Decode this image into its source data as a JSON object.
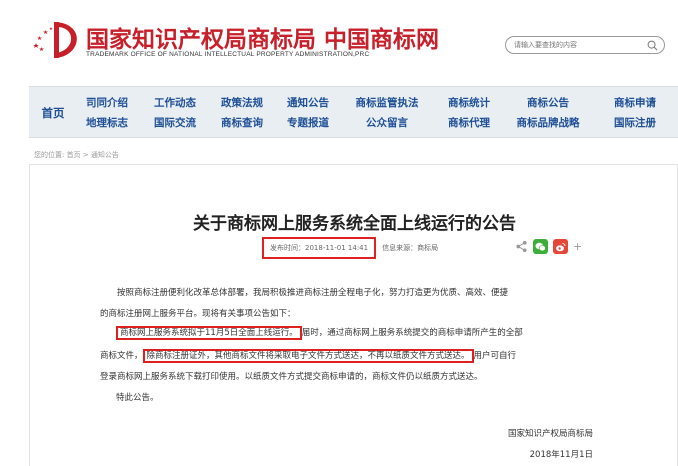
{
  "header": {
    "title_cn": "国家知识产权局商标局 中国商标网",
    "title_en": "TRADEMARK OFFICE OF NATIONAL INTELLECTUAL PROPERTY ADMINISTRATION,PRC",
    "search_placeholder": "请输入要查找的内容"
  },
  "nav": {
    "home": "首页",
    "items": [
      {
        "line1": "司同介绍",
        "line2": "地理标志"
      },
      {
        "line1": "工作动态",
        "line2": "国际交流"
      },
      {
        "line1": "政策法规",
        "line2": "商标查询"
      },
      {
        "line1": "通知公告",
        "line2": "专题报道"
      },
      {
        "line1": "商标监管执法",
        "line2": "公众留言"
      },
      {
        "line1": "商标统计",
        "line2": "商标代理"
      },
      {
        "line1": "商标公告",
        "line2": "商标品牌战略"
      },
      {
        "line1": "商标申请",
        "line2": "国际注册"
      }
    ]
  },
  "breadcrumb": "您的位置: 首页 > 通知公告",
  "article": {
    "title": "关于商标网上服务系统全面上线运行的公告",
    "publish_time": "发布时间：2018-11-01 14:41",
    "source": "信息来源：商标局",
    "p1_line1": "按照商标注册便利化改革总体部署，我局积极推进商标注册全程电子化，努力打造更为优质、高效、便捷",
    "p1_line2": "的商标注册网上服务平台。现将有关事项公告如下：",
    "p2_highlight1": "商标网上服务系统拟于11月5日全面上线运行。",
    "p2_line1_rest": "届时，通过商标网上服务系统提交的商标申请所产生的全部",
    "p2_line2_start": "商标文件，",
    "p2_highlight2": "除商标注册证外，其他商标文件将采取电子文件方式送达，不再以纸质文件方式送达。",
    "p2_line2_rest": "用户可自行",
    "p2_line3": "登录商标网上服务系统下载打印使用。以纸质文件方式提交商标申请的，商标文件仍以纸质方式送达。",
    "p3": "特此公告。",
    "signature": "国家知识产权局商标局",
    "date": "2018年11月1日"
  },
  "colors": {
    "brand_red": "#c8202a",
    "nav_blue": "#1e4f96",
    "highlight_red": "#e0201f"
  },
  "icons": [
    "logo-emblem",
    "search-icon",
    "share-icon",
    "wechat-icon",
    "weibo-icon",
    "plus-icon"
  ]
}
